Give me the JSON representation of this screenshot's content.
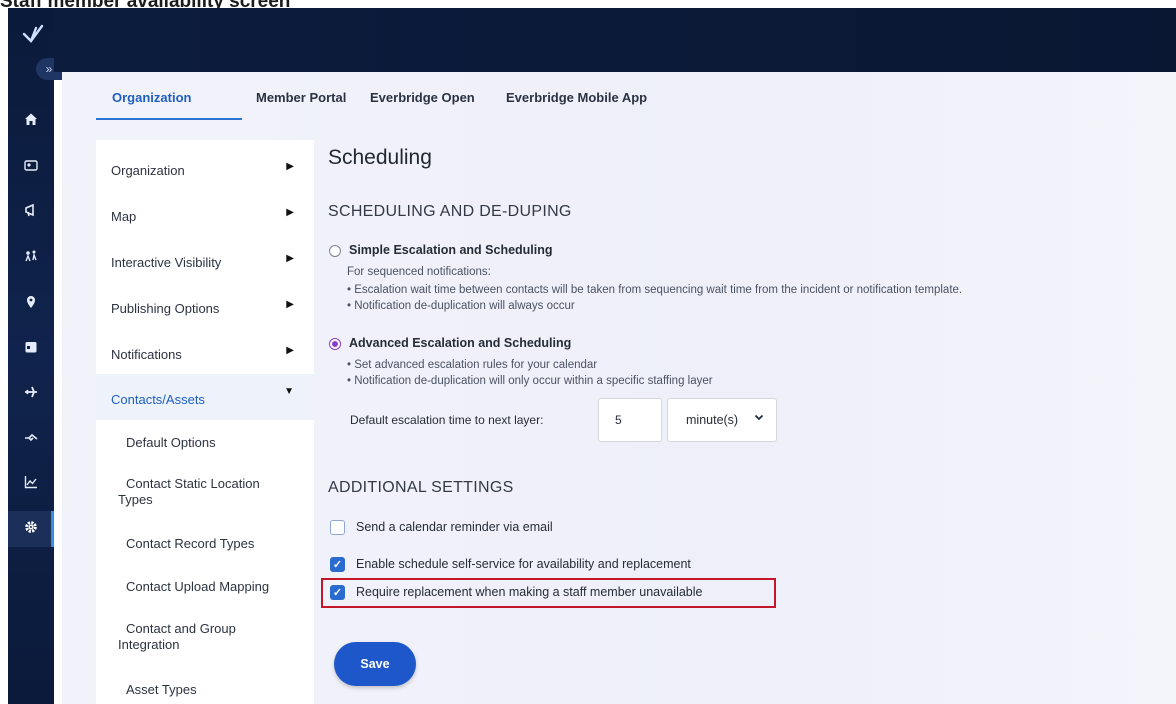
{
  "caption": "Staff member availability screen",
  "header": {
    "tabs": [
      {
        "label": "Organization",
        "active": true
      },
      {
        "label": "Member Portal",
        "active": false
      },
      {
        "label": "Everbridge Open",
        "active": false
      },
      {
        "label": "Everbridge Mobile App",
        "active": false
      }
    ],
    "accent_color": "#1f5fbf"
  },
  "rail": {
    "expand_label": "»",
    "icons": [
      "home-icon",
      "contacts-icon",
      "megaphone-icon",
      "people-icon",
      "location-icon",
      "calendar-icon",
      "plane-icon",
      "handshake-icon",
      "chart-icon",
      "gear-icon"
    ]
  },
  "sidebar": {
    "items": [
      {
        "label": "Organization",
        "arrow": "▶"
      },
      {
        "label": "Map",
        "arrow": "▶"
      },
      {
        "label": "Interactive Visibility",
        "arrow": "▶"
      },
      {
        "label": "Publishing Options",
        "arrow": "▶"
      },
      {
        "label": "Notifications",
        "arrow": "▶"
      },
      {
        "label": "Contacts/Assets",
        "arrow": "▼"
      }
    ],
    "subitems": [
      "Default Options",
      "Contact Static Location Types",
      "Contact Record Types",
      "Contact Upload Mapping",
      "Contact and Group Integration",
      "Asset Types"
    ]
  },
  "content": {
    "title": "Scheduling",
    "section1_title": "SCHEDULING AND DE-DUPING",
    "simple": {
      "label": "Simple Escalation and Scheduling",
      "desc0": "For sequenced notifications:",
      "desc1": "• Escalation wait time between contacts will be taken from sequencing wait time from the incident or notification template.",
      "desc2": "• Notification de-duplication will always occur"
    },
    "advanced": {
      "label": "Advanced Escalation and Scheduling",
      "desc1": "• Set advanced escalation rules for your calendar",
      "desc2": "• Notification de-duplication will only occur within a specific staffing layer"
    },
    "escalation_label": "Default escalation time to next layer:",
    "escalation_value": "5",
    "escalation_unit": "minute(s)",
    "section2_title": "ADDITIONAL SETTINGS",
    "checkboxes": [
      {
        "label": "Send a calendar reminder via email",
        "checked": false
      },
      {
        "label": "Enable schedule self-service for availability and replacement",
        "checked": true
      },
      {
        "label": "Require replacement when making a staff member unavailable",
        "checked": true
      }
    ],
    "save_label": "Save"
  }
}
